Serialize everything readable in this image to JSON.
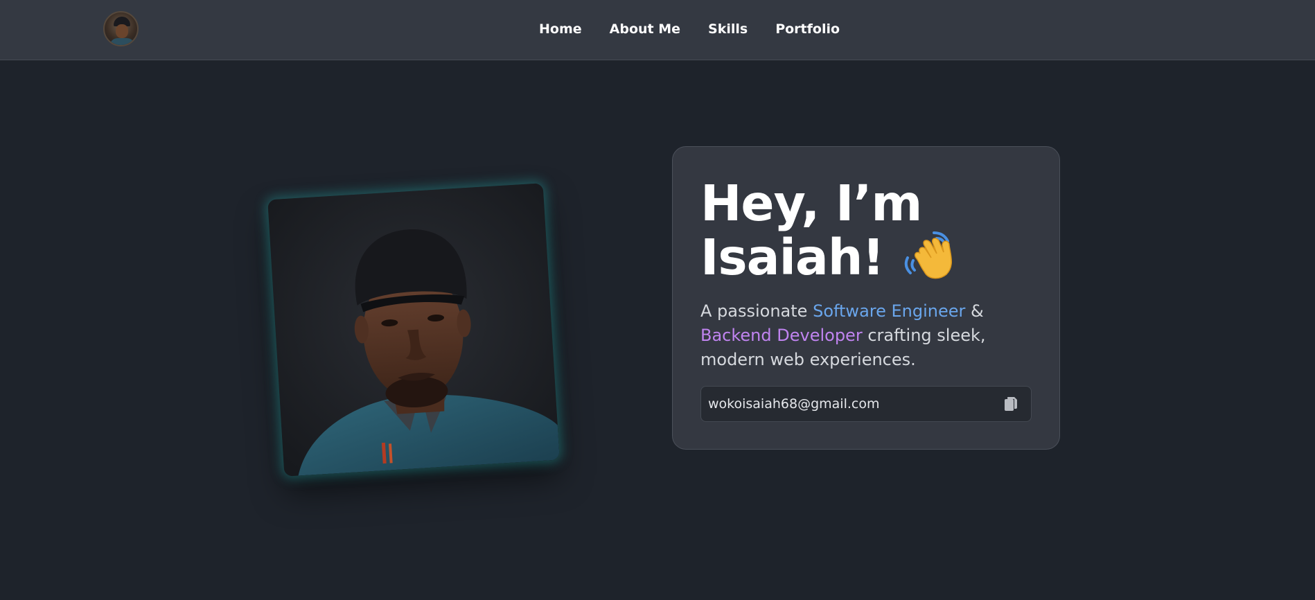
{
  "nav": {
    "links": [
      "Home",
      "About Me",
      "Skills",
      "Portfolio"
    ]
  },
  "hero": {
    "title_line1": "Hey, I’m",
    "title_line2": "Isaiah!",
    "desc_prefix": "A passionate ",
    "desc_role1": "Software Engineer",
    "desc_amp": " & ",
    "desc_role2": "Backend Developer",
    "desc_suffix": " crafting sleek, modern web experiences.",
    "email": "wokoisaiah68@gmail.com"
  },
  "icons": {
    "wave": "waving-hand-icon",
    "copy": "copy-icon"
  },
  "colors": {
    "background": "#1e232b",
    "navbar": "#343942",
    "card": "#343841",
    "accent_blue": "#6aa6ec",
    "accent_purple": "#c084f0",
    "photo_glow": "#26a0a0"
  }
}
